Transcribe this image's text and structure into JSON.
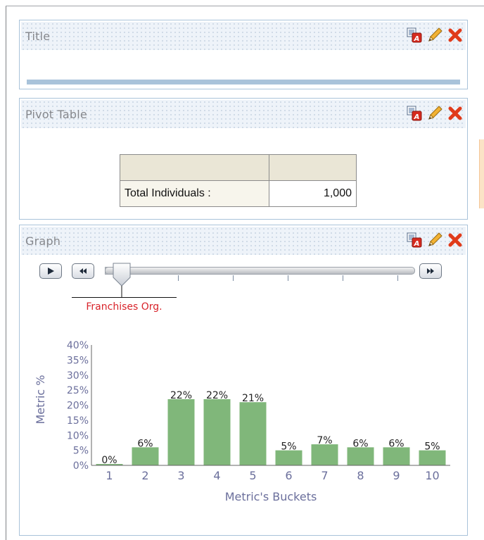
{
  "panels": {
    "title_panel": {
      "title": "Title"
    },
    "pivot_panel": {
      "title": "Pivot Table",
      "row_label": "Total Individuals :",
      "row_value": "1,000"
    },
    "graph_panel": {
      "title": "Graph",
      "slider": {
        "selected_label": "Franchises Org."
      }
    }
  },
  "icons": [
    "format-icon",
    "edit-pencil-icon",
    "delete-x-icon",
    "play-icon",
    "rewind-icon",
    "fast-forward-icon"
  ],
  "colors": {
    "bar": "#80b77a",
    "axis_text": "#6b6f9c",
    "delete": "#e03b1a",
    "slider_label": "#d8232a"
  },
  "chart_data": {
    "type": "bar",
    "categories": [
      "1",
      "2",
      "3",
      "4",
      "5",
      "6",
      "7",
      "8",
      "9",
      "10"
    ],
    "values": [
      0,
      6,
      22,
      22,
      21,
      5,
      7,
      6,
      6,
      5
    ],
    "data_labels": [
      "0%",
      "6%",
      "22%",
      "22%",
      "21%",
      "5%",
      "7%",
      "6%",
      "6%",
      "5%"
    ],
    "y_ticks": [
      "0%",
      "5%",
      "10%",
      "15%",
      "20%",
      "25%",
      "30%",
      "35%",
      "40%"
    ],
    "ylim": [
      0,
      40
    ],
    "xlabel": "Metric's Buckets",
    "ylabel": "Metric %",
    "grid": false,
    "legend": "none"
  }
}
